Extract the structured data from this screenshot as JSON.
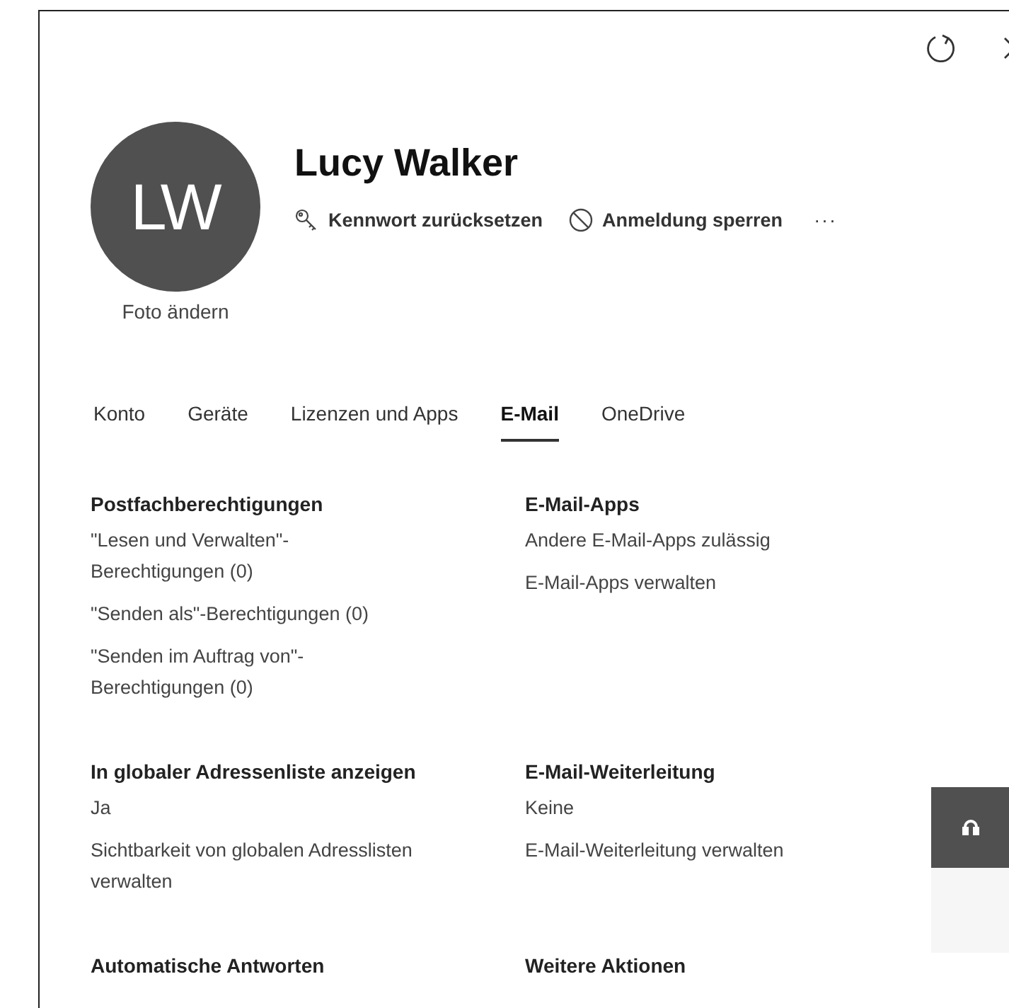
{
  "user": {
    "initials": "LW",
    "name": "Lucy Walker",
    "photo_link": "Foto ändern"
  },
  "actions": [
    {
      "kind": "key",
      "label": "Kennwort zurücksetzen"
    },
    {
      "kind": "block",
      "label": "Anmeldung sperren"
    },
    {
      "kind": "more",
      "label": "···"
    }
  ],
  "tabs": [
    {
      "label": "Konto",
      "selected": false
    },
    {
      "label": "Geräte",
      "selected": false
    },
    {
      "label": "Lizenzen und Apps",
      "selected": false
    },
    {
      "label": "E-Mail",
      "selected": true
    },
    {
      "label": "OneDrive",
      "selected": false
    }
  ],
  "sections": [
    {
      "title": "Postfachberechtigungen",
      "items": [
        "\"Lesen und Verwalten\"-Berechtigungen (0)",
        "\"Senden als\"-Berechtigungen (0)",
        "\"Senden im Auftrag von\"-Berechtigungen (0)"
      ]
    },
    {
      "title": "E-Mail-Apps",
      "items": [
        "Andere E-Mail-Apps zulässig",
        "E-Mail-Apps verwalten"
      ]
    },
    {
      "title": "In globaler Adressenliste anzeigen",
      "items": [
        "Ja",
        "Sichtbarkeit von globalen Adresslisten verwalten"
      ]
    },
    {
      "title": "E-Mail-Weiterleitung",
      "items": [
        "Keine",
        "E-Mail-Weiterleitung verwalten"
      ]
    },
    {
      "title": "Automatische Antworten"
    },
    {
      "title": "Weitere Aktionen"
    }
  ]
}
